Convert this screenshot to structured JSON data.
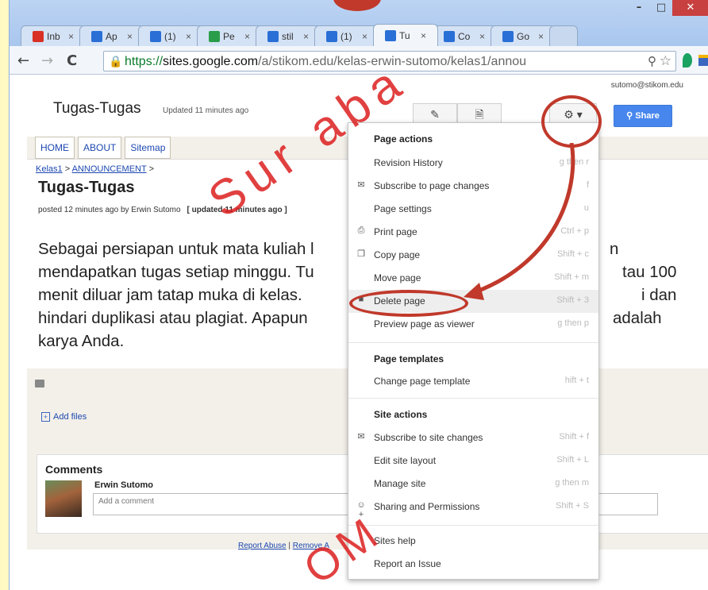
{
  "browser": {
    "tabs": [
      {
        "label": "Inb",
        "icon": "gmail-icon",
        "color": "#d93025"
      },
      {
        "label": "Ap",
        "icon": "sites-icon",
        "color": "#2a6fd6"
      },
      {
        "label": "(1)",
        "icon": "chat-icon",
        "color": "#2a6fd6"
      },
      {
        "label": "Pe",
        "icon": "drive-icon",
        "color": "#2a9d4a"
      },
      {
        "label": "stil",
        "icon": "sites-icon",
        "color": "#2a6fd6"
      },
      {
        "label": "(1)",
        "icon": "chat-icon",
        "color": "#2a6fd6"
      },
      {
        "label": "Tu",
        "icon": "sites-icon",
        "color": "#2a6fd6",
        "active": true
      },
      {
        "label": "Co",
        "icon": "arrow-icon",
        "color": "#2a6fd6"
      },
      {
        "label": "Go",
        "icon": "chat-icon",
        "color": "#2a6fd6"
      }
    ],
    "url": {
      "scheme": "https://",
      "host": "sites.google.com",
      "path": "/a/stikom.edu/kelas-erwin-sutomo/kelas1/annou"
    }
  },
  "header": {
    "account": "sutomo@stikom.edu",
    "site_title": "Tugas-Tugas",
    "updated": "Updated 11 minutes ago",
    "share": "Share"
  },
  "nav": {
    "tabs": [
      "HOME",
      "ABOUT",
      "Sitemap"
    ]
  },
  "page": {
    "breadcrumb": {
      "kelas": "Kelas1",
      "announcement": "ANNOUNCEMENT",
      "sep": ">"
    },
    "title": "Tugas-Tugas",
    "posted": "posted 12 minutes ago by Erwin Sutomo",
    "posted_updated": "[ updated 11 minutes ago ]",
    "body_lines": [
      "Sebagai persiapan untuk mata kuliah l",
      "mendapatkan tugas setiap minggu. Tu",
      "menit diluar jam tatap muka di kelas.",
      "hindari duplikasi atau plagiat. Apapun",
      "karya Anda."
    ],
    "body_right": [
      "n",
      "tau 100",
      "i dan",
      "adalah"
    ],
    "add_files": "Add files"
  },
  "comments": {
    "title": "Comments",
    "user": "Erwin Sutomo",
    "placeholder": "Add a comment"
  },
  "footer": {
    "report_abuse": "Report Abuse",
    "remove": "Remove A"
  },
  "menu": {
    "page_actions_title": "Page actions",
    "items": [
      {
        "label": "Revision History",
        "key": "g then r",
        "icon": ""
      },
      {
        "label": "Subscribe to page changes",
        "key": "f",
        "icon": "mail-icon"
      },
      {
        "label": "Page settings",
        "key": "u",
        "icon": ""
      },
      {
        "label": "Print page",
        "key": "Ctrl + p",
        "icon": "print-icon"
      },
      {
        "label": "Copy page",
        "key": "Shift + c",
        "icon": "copy-icon"
      },
      {
        "label": "Move page",
        "key": "Shift + m",
        "icon": ""
      },
      {
        "label": "Delete page",
        "key": "Shift + 3",
        "icon": "trash-icon"
      },
      {
        "label": "Preview page as viewer",
        "key": "g then p",
        "icon": ""
      }
    ],
    "page_templates_title": "Page templates",
    "templates_items": [
      {
        "label": "Change page template",
        "key": "hift + t",
        "icon": ""
      }
    ],
    "site_actions_title": "Site actions",
    "site_items": [
      {
        "label": "Subscribe to site changes",
        "key": "Shift + f",
        "icon": "mail-icon"
      },
      {
        "label": "Edit site layout",
        "key": "Shift + L",
        "icon": ""
      },
      {
        "label": "Manage site",
        "key": "g then m",
        "icon": ""
      },
      {
        "label": "Sharing and Permissions",
        "key": "Shift + S",
        "icon": "add-person-icon"
      }
    ],
    "help_items": [
      {
        "label": "Sites help"
      },
      {
        "label": "Report an Issue"
      }
    ]
  },
  "overlay": {
    "watermark": "Sur aba",
    "watermark_bottom": "OM",
    "accent": "#c0392b"
  }
}
